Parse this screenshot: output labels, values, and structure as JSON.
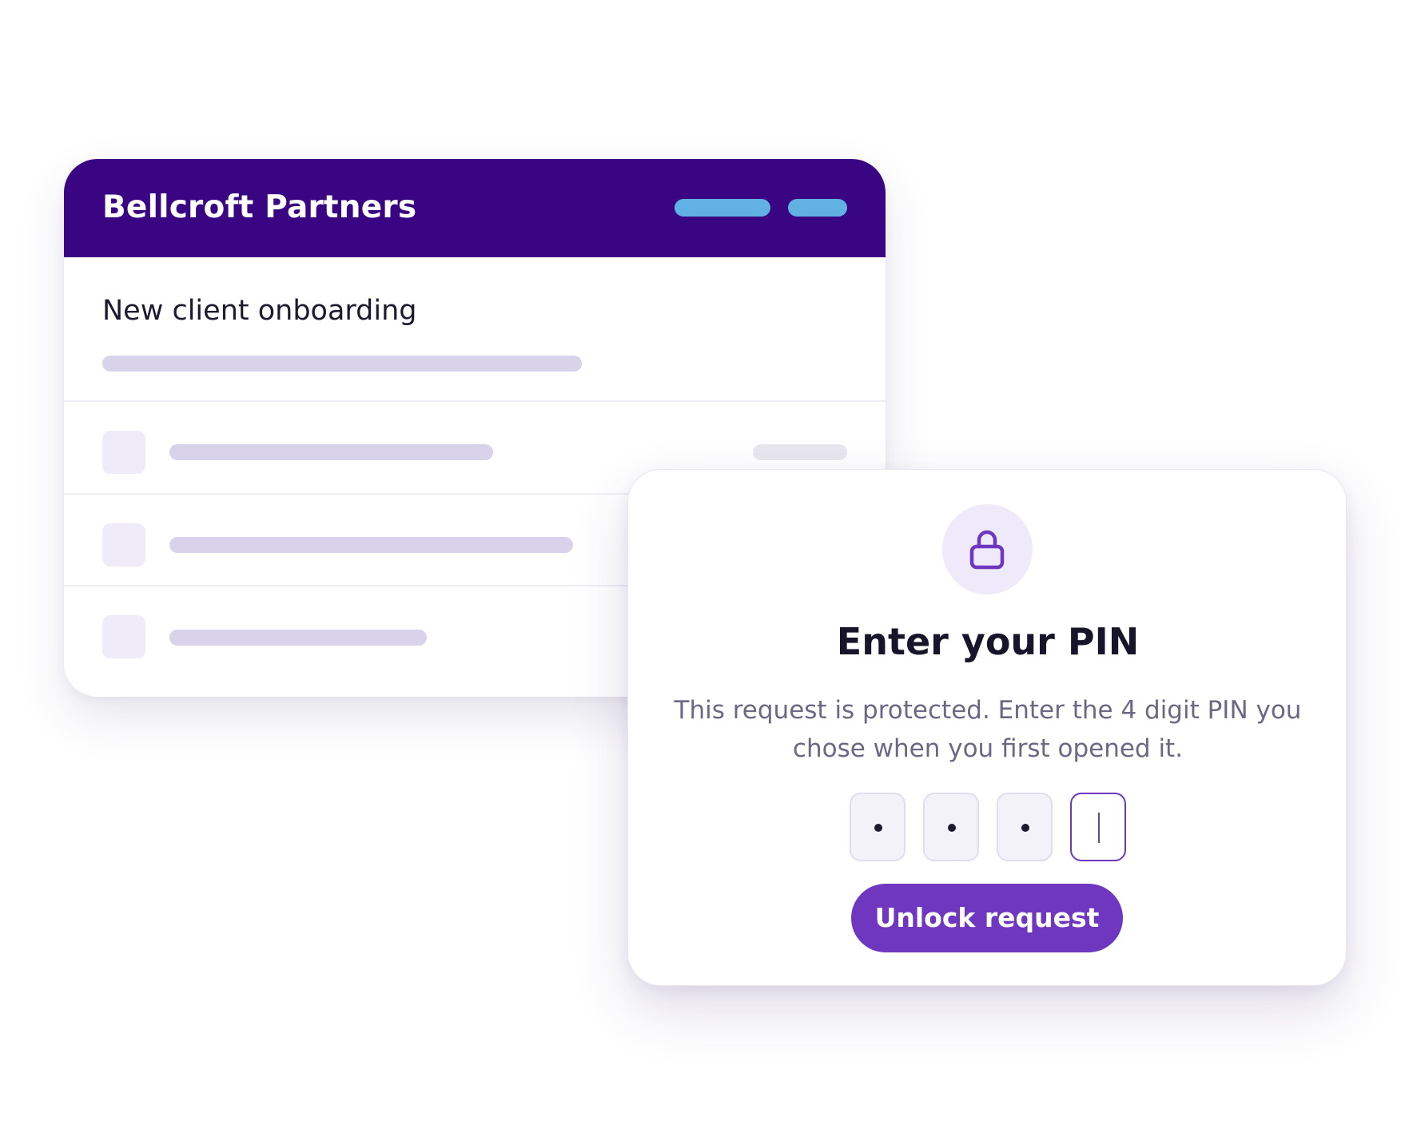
{
  "colors": {
    "brand": "#3a0582",
    "accent": "#6f37c0",
    "header_pill": "#62b1e4",
    "skeleton": "#d8d2ea"
  },
  "back_card": {
    "company_name": "Bellcroft Partners",
    "header_pills": [
      "placeholder-pill",
      "placeholder-pill"
    ],
    "title": "New client onboarding",
    "rows": [
      {
        "has_meta": true
      },
      {
        "has_meta": false
      },
      {
        "has_meta": false
      }
    ]
  },
  "pin_dialog": {
    "icon": "lock-icon",
    "title": "Enter your PIN",
    "description": "This request is protected. Enter the 4 digit PIN you chose when you first opened it.",
    "pin_length": 4,
    "filled_digits": 3,
    "button_label": "Unlock request"
  }
}
